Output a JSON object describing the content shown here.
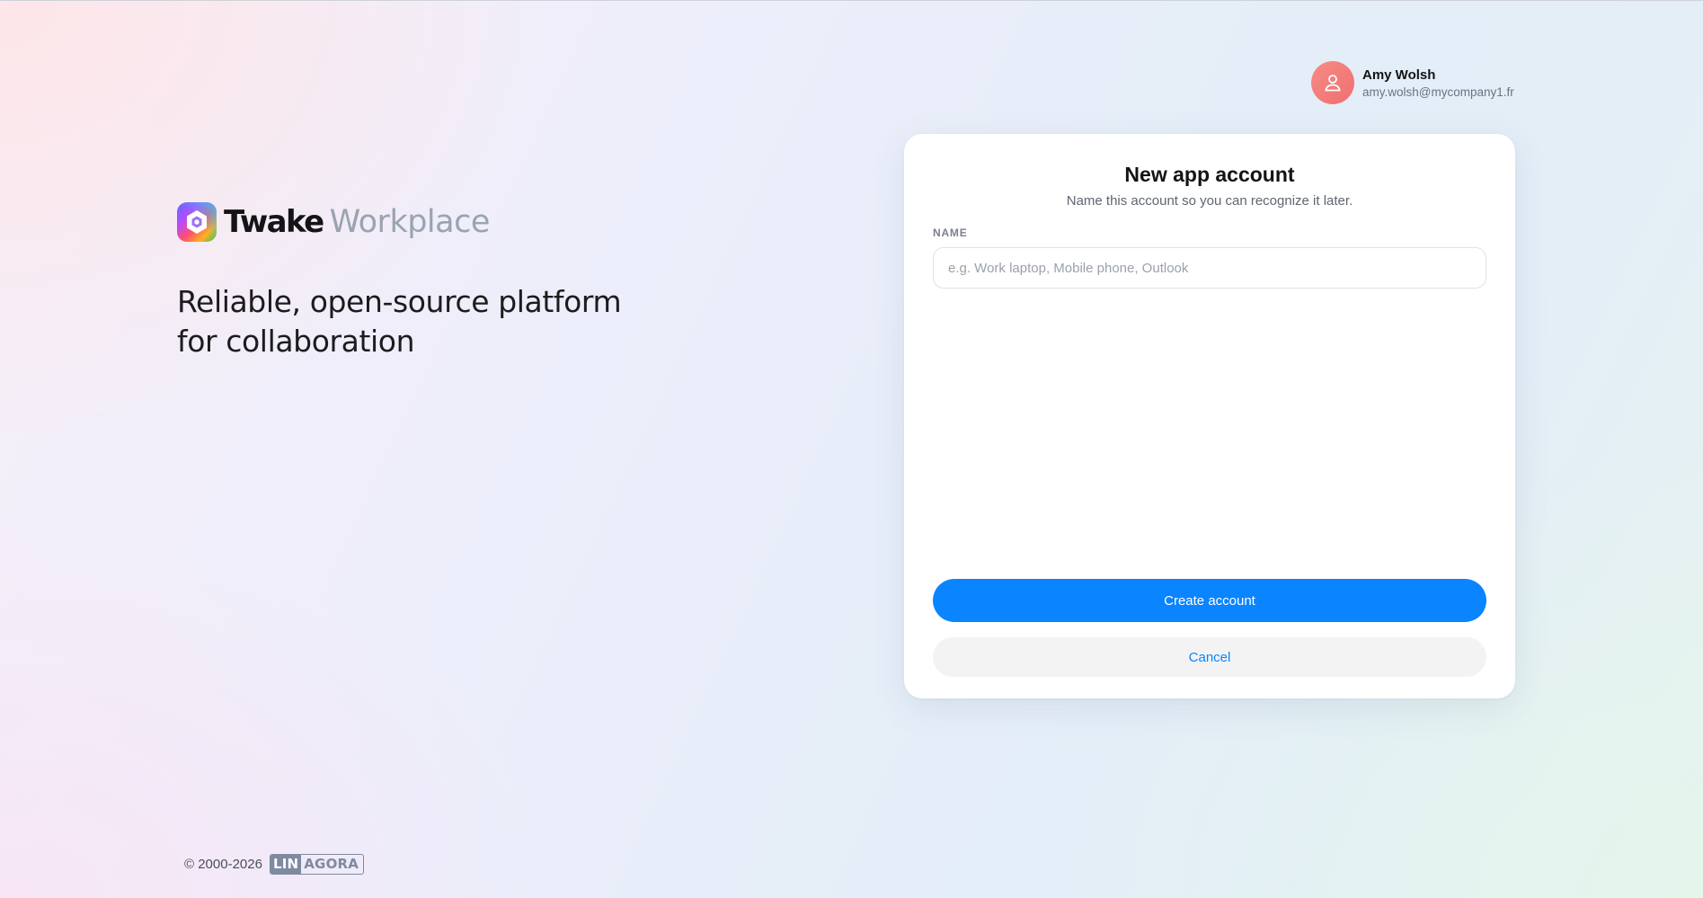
{
  "brand": {
    "name": "Twake",
    "product": "Workplace",
    "tagline_line1": "Reliable, open-source platform",
    "tagline_line2": "for collaboration",
    "logo_icon": "twake-logo-icon"
  },
  "user": {
    "name": "Amy Wolsh",
    "email": "amy.wolsh@mycompany1.fr",
    "avatar_icon": "user-icon",
    "avatar_color": "#f07a78"
  },
  "dialog": {
    "title": "New app account",
    "subtitle": "Name this account so you can recognize it later.",
    "name_label": "NAME",
    "name_value": "",
    "name_placeholder": "e.g. Work laptop, Mobile phone, Outlook",
    "create_label": "Create account",
    "cancel_label": "Cancel"
  },
  "footer": {
    "copyright": "© 2000-2026",
    "company_part1": "LIN",
    "company_part2": "AGORA"
  },
  "colors": {
    "accent": "#0a84ff",
    "secondary_button_bg": "#f3f3f4"
  }
}
